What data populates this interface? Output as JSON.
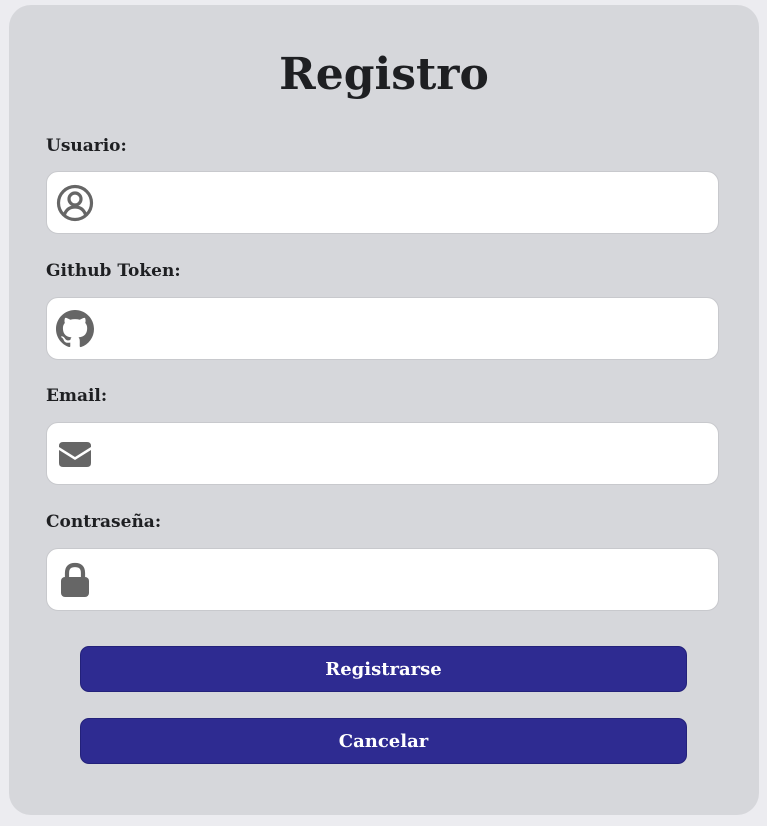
{
  "form": {
    "title": "Registro",
    "fields": [
      {
        "label": "Usuario:",
        "icon": "user-circle-icon",
        "value": "",
        "placeholder": ""
      },
      {
        "label": "Github Token:",
        "icon": "github-icon",
        "value": "",
        "placeholder": ""
      },
      {
        "label": "Email:",
        "icon": "envelope-icon",
        "value": "",
        "placeholder": ""
      },
      {
        "label": "Contraseña:",
        "icon": "lock-icon",
        "value": "",
        "placeholder": ""
      }
    ],
    "buttons": {
      "register_label": "Registrarse",
      "cancel_label": "Cancelar"
    }
  },
  "colors": {
    "page_background": "#ececf0",
    "card_background": "#d6d7db",
    "button_primary": "#2e2b91",
    "icon_color": "#666666",
    "text_dark": "#1e1f22"
  }
}
